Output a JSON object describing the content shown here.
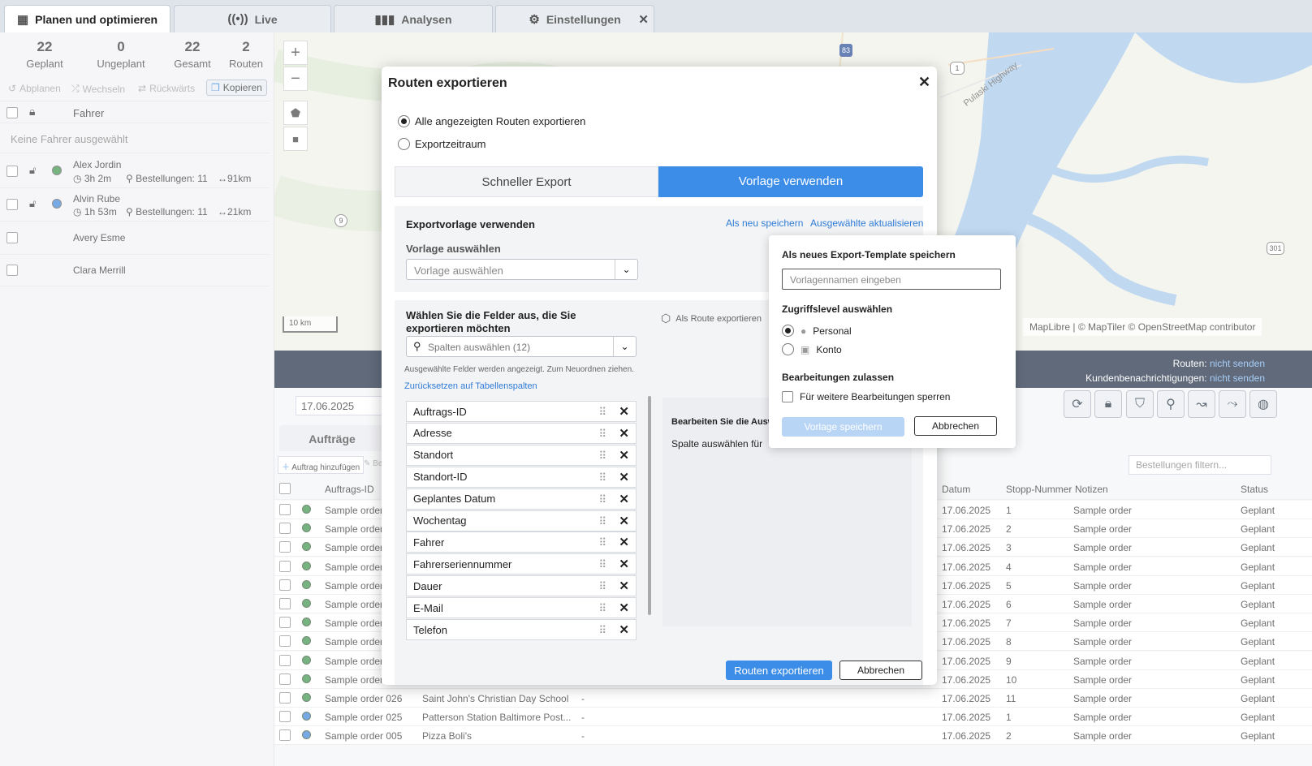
{
  "tabs": [
    {
      "label": "Planen und optimieren",
      "icon": "calendar-icon"
    },
    {
      "label": "Live",
      "icon": "broadcast-icon"
    },
    {
      "label": "Analysen",
      "icon": "bar-chart-icon"
    },
    {
      "label": "Einstellungen",
      "icon": "gear-icon"
    }
  ],
  "stats": [
    {
      "value": "22",
      "label": "Geplant"
    },
    {
      "value": "0",
      "label": "Ungeplant"
    },
    {
      "value": "22",
      "label": "Gesamt"
    },
    {
      "value": "2",
      "label": "Routen"
    }
  ],
  "actions": [
    "Abplanen",
    "Wechseln",
    "Rückwärts",
    "Kopieren"
  ],
  "drivers_header": "Fahrer",
  "no_driver": "Keine Fahrer ausgewählt",
  "drivers": [
    {
      "name": "Alex Jordin",
      "time": "3h 2m",
      "orders": "Bestellungen: 11",
      "dist": "91km",
      "color": "#2e8b3e"
    },
    {
      "name": "Alvin Rube",
      "time": "1h 53m",
      "orders": "Bestellungen: 11",
      "dist": "21km",
      "color": "#2f7bd6"
    },
    {
      "name": "Avery Esme"
    },
    {
      "name": "Clara Merrill"
    }
  ],
  "map": {
    "scale": "10 km",
    "attribution": "MapLibre | © MapTiler © OpenStreetMap contributor",
    "road_label": "Pulaski Highway",
    "shields": [
      "83",
      "1",
      "301",
      "9"
    ]
  },
  "status": {
    "routes_label": "Routen:",
    "routes_value": "nicht senden",
    "notif_label": "Kundenbenachrichtigungen:",
    "notif_value": "nicht senden"
  },
  "date": "17.06.2025",
  "orders_tab": "Aufträge",
  "add_order": "Auftrag hinzufügen",
  "edit_stub": "Be",
  "filter_placeholder": "Bestellungen filtern...",
  "table_headers": {
    "id": "Auftrags-ID",
    "date": "Datum",
    "stop": "Stopp-Nummer",
    "notes": "Notizen",
    "status": "Status"
  },
  "rows": [
    {
      "id": "Sample order",
      "addr": "",
      "dash": "",
      "date": "17.06.2025",
      "stop": "1",
      "notes": "Sample order",
      "status": "Geplant",
      "color": "#2e8b3e"
    },
    {
      "id": "Sample order",
      "addr": "",
      "dash": "",
      "date": "17.06.2025",
      "stop": "2",
      "notes": "Sample order",
      "status": "Geplant",
      "color": "#2e8b3e"
    },
    {
      "id": "Sample order",
      "addr": "",
      "dash": "",
      "date": "17.06.2025",
      "stop": "3",
      "notes": "Sample order",
      "status": "Geplant",
      "color": "#2e8b3e"
    },
    {
      "id": "Sample order",
      "addr": "",
      "dash": "",
      "date": "17.06.2025",
      "stop": "4",
      "notes": "Sample order",
      "status": "Geplant",
      "color": "#2e8b3e"
    },
    {
      "id": "Sample order",
      "addr": "",
      "dash": "",
      "date": "17.06.2025",
      "stop": "5",
      "notes": "Sample order",
      "status": "Geplant",
      "color": "#2e8b3e"
    },
    {
      "id": "Sample order",
      "addr": "",
      "dash": "",
      "date": "17.06.2025",
      "stop": "6",
      "notes": "Sample order",
      "status": "Geplant",
      "color": "#2e8b3e"
    },
    {
      "id": "Sample order",
      "addr": "",
      "dash": "",
      "date": "17.06.2025",
      "stop": "7",
      "notes": "Sample order",
      "status": "Geplant",
      "color": "#2e8b3e"
    },
    {
      "id": "Sample order",
      "addr": "",
      "dash": "",
      "date": "17.06.2025",
      "stop": "8",
      "notes": "Sample order",
      "status": "Geplant",
      "color": "#2e8b3e"
    },
    {
      "id": "Sample order",
      "addr": "",
      "dash": "",
      "date": "17.06.2025",
      "stop": "9",
      "notes": "Sample order",
      "status": "Geplant",
      "color": "#2e8b3e"
    },
    {
      "id": "Sample order",
      "addr": "",
      "dash": "",
      "date": "17.06.2025",
      "stop": "10",
      "notes": "Sample order",
      "status": "Geplant",
      "color": "#2e8b3e"
    },
    {
      "id": "Sample order 026",
      "addr": "Saint John's Christian Day School",
      "dash": "-",
      "date": "17.06.2025",
      "stop": "11",
      "notes": "Sample order",
      "status": "Geplant",
      "color": "#2e8b3e"
    },
    {
      "id": "Sample order 025",
      "addr": "Patterson Station Baltimore Post...",
      "dash": "-",
      "date": "17.06.2025",
      "stop": "1",
      "notes": "Sample order",
      "status": "Geplant",
      "color": "#2f7bd6"
    },
    {
      "id": "Sample order 005",
      "addr": "Pizza Boli's",
      "dash": "-",
      "date": "17.06.2025",
      "stop": "2",
      "notes": "Sample order",
      "status": "Geplant",
      "color": "#2f7bd6"
    }
  ],
  "modal": {
    "title": "Routen exportieren",
    "opt_all": "Alle angezeigten Routen exportieren",
    "opt_range": "Exportzeitraum",
    "tab_quick": "Schneller Export",
    "tab_template": "Vorlage verwenden",
    "tpl_title": "Exportvorlage verwenden",
    "save_new": "Als neu speichern",
    "update_sel": "Ausgewählte aktualisieren",
    "tpl_select_label": "Vorlage auswählen",
    "tpl_select_placeholder": "Vorlage auswählen",
    "fields_title": "Wählen Sie die Felder aus, die Sie exportieren möchten",
    "as_route": "Als Route exportieren",
    "col_select": "Spalten auswählen (12)",
    "hint": "Ausgewählte Felder werden angezeigt. Zum Neuordnen ziehen.",
    "reset": "Zurücksetzen auf Tabellenspalten",
    "fields": [
      "Auftrags-ID",
      "Adresse",
      "Standort",
      "Standort-ID",
      "Geplantes Datum",
      "Wochentag",
      "Fahrer",
      "Fahrerseriennummer",
      "Dauer",
      "E-Mail",
      "Telefon"
    ],
    "edit_title": "Bearbeiten Sie die Auswahl",
    "edit_sub": "Spalte auswählen für",
    "export_btn": "Routen exportieren",
    "cancel_btn": "Abbrechen"
  },
  "popover": {
    "title": "Als neues Export-Template speichern",
    "name_placeholder": "Vorlagennamen eingeben",
    "access_title": "Zugriffslevel auswählen",
    "personal": "Personal",
    "account": "Konto",
    "edit_title": "Bearbeitungen zulassen",
    "lock": "Für weitere Bearbeitungen sperren",
    "save": "Vorlage speichern",
    "cancel": "Abbrechen"
  },
  "colors": {
    "accent": "#2f7bd6",
    "dark": "#0b1b33"
  }
}
